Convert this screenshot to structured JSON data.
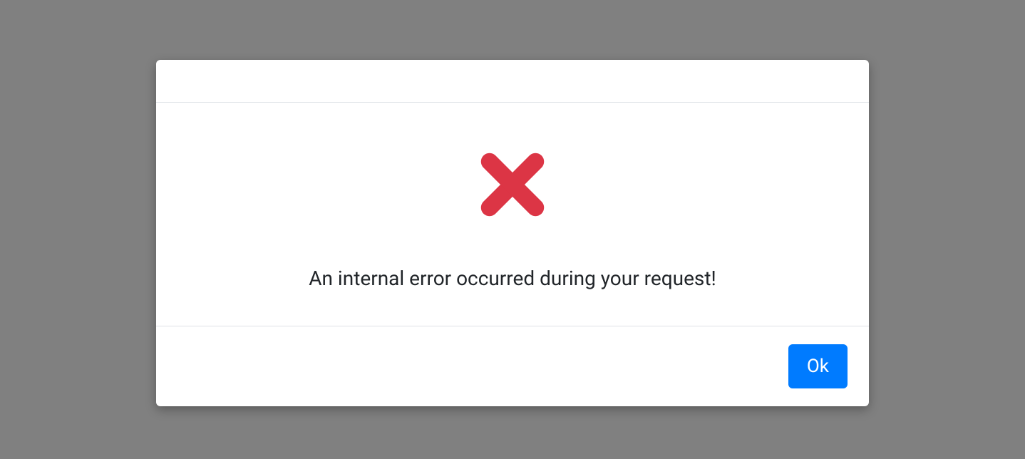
{
  "modal": {
    "message": "An internal error occurred during your request!",
    "ok_label": "Ok",
    "icon_color": "#dc3545",
    "button_color": "#007bff"
  }
}
